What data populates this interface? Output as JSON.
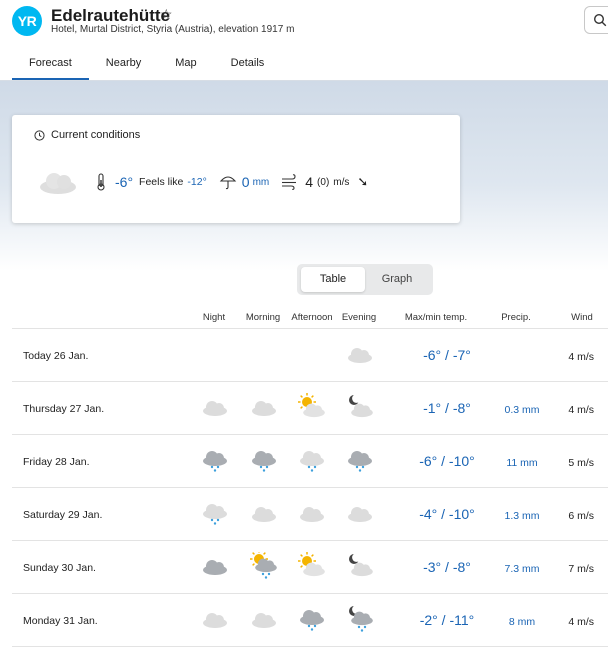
{
  "header": {
    "logo_text": "YR",
    "title": "Edelrautehütte",
    "star": "☆",
    "subtitle": "Hotel, Murtal District, Styria (Austria), elevation 1917 m"
  },
  "tabs": [
    {
      "label": "Forecast",
      "active": true
    },
    {
      "label": "Nearby"
    },
    {
      "label": "Map"
    },
    {
      "label": "Details"
    }
  ],
  "current": {
    "heading": "Current conditions",
    "temperature": "-6°",
    "feels_like_label": "Feels like",
    "feels_like_value": "-12°",
    "precip_value": "0",
    "precip_unit": "mm",
    "wind_value": "4",
    "wind_gust": "(0)",
    "wind_unit": "m/s",
    "wind_arrow": "➘",
    "icon": "cloud-icon"
  },
  "toggle": {
    "table_label": "Table",
    "graph_label": "Graph",
    "selected": "Table"
  },
  "columns": {
    "night": "Night",
    "morning": "Morning",
    "afternoon": "Afternoon",
    "evening": "Evening",
    "maxmin": "Max/min temp.",
    "precip": "Precip.",
    "wind": "Wind"
  },
  "rows": [
    {
      "day": "Today 26 Jan.",
      "icons": [
        "",
        "",
        "",
        "cloud"
      ],
      "temp": "-6° / -7°",
      "precip": "",
      "wind": "4 m/s"
    },
    {
      "day": "Thursday 27 Jan.",
      "icons": [
        "cloud",
        "cloud",
        "sun-cloud",
        "moon-cloud"
      ],
      "temp": "-1° / -8°",
      "precip": "0.3 mm",
      "wind": "4 m/s"
    },
    {
      "day": "Friday 28 Jan.",
      "icons": [
        "snow-dark",
        "snow-dark",
        "snow",
        "snow-dark"
      ],
      "temp": "-6° / -10°",
      "precip": "11 mm",
      "wind": "5 m/s"
    },
    {
      "day": "Saturday 29 Jan.",
      "icons": [
        "snow",
        "cloud",
        "cloud",
        "cloud"
      ],
      "temp": "-4° / -10°",
      "precip": "1.3 mm",
      "wind": "6 m/s"
    },
    {
      "day": "Sunday 30 Jan.",
      "icons": [
        "cloud-dark",
        "sun-snow",
        "sun-cloud",
        "moon-cloud"
      ],
      "temp": "-3° / -8°",
      "precip": "7.3 mm",
      "wind": "7 m/s"
    },
    {
      "day": "Monday 31 Jan.",
      "icons": [
        "cloud",
        "cloud",
        "snow-dark",
        "moon-snow"
      ],
      "temp": "-2° / -11°",
      "precip": "8 mm",
      "wind": "4 m/s"
    }
  ],
  "colors": {
    "accent": "#1a64b4",
    "logo": "#00b8f1"
  }
}
